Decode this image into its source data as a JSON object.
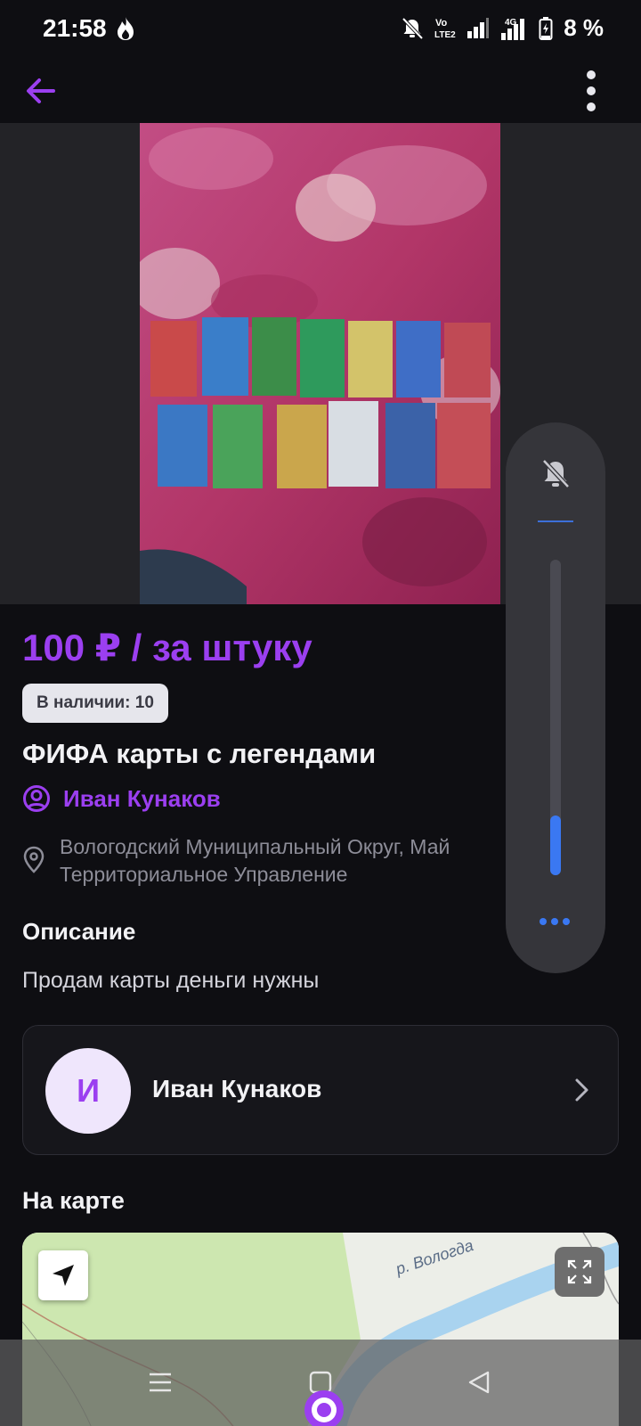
{
  "status_bar": {
    "time": "21:58",
    "battery": "8 %",
    "icons": [
      "flame-icon",
      "bell-muted-icon",
      "volte-icon",
      "signal-icon",
      "4g-signal-icon",
      "battery-charging-icon"
    ]
  },
  "app_bar": {
    "icons": [
      "arrow-left-icon",
      "more-vertical-icon"
    ]
  },
  "listing": {
    "price": "100 ₽ / за штуку",
    "stock": "В наличии: 10",
    "title": "ФИФА карты с легендами",
    "seller_name": "Иван Кунаков",
    "location_line1": "Вологодский Муниципальный Округ, Май",
    "location_line2": "Территориальное Управление"
  },
  "description": {
    "heading": "Описание",
    "text": "Продам карты деньги нужны"
  },
  "seller_card": {
    "initial": "И",
    "name": "Иван Кунаков"
  },
  "map": {
    "heading": "На карте",
    "river_label": "р. Вологда"
  },
  "volume": {
    "level": 0.19
  },
  "colors": {
    "accent": "#9b3ff0",
    "background": "#0e0e12",
    "volume_blue": "#3a78f2"
  }
}
